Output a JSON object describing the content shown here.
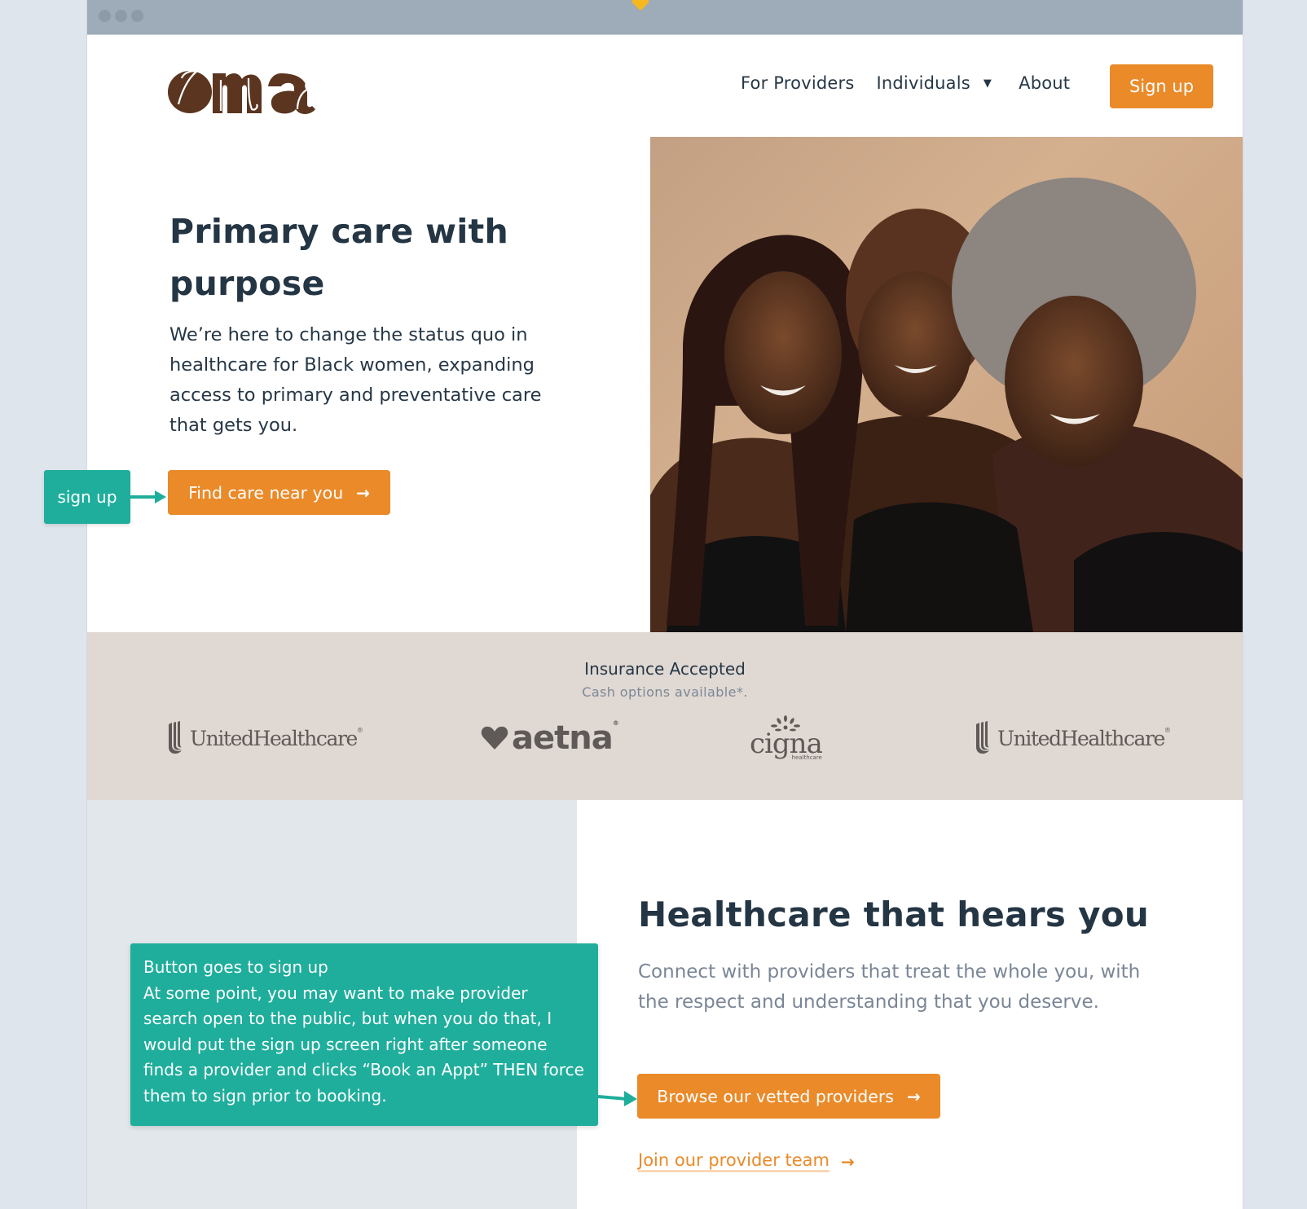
{
  "browser": {
    "window_controls": [
      "close",
      "minimize",
      "maximize"
    ],
    "marker_color": "#f5b820"
  },
  "header": {
    "logo_text": "oma",
    "logo_color": "#5b3520",
    "nav": [
      {
        "label": "For Providers",
        "has_dropdown": false
      },
      {
        "label": "Individuals",
        "has_dropdown": true
      },
      {
        "label": "About",
        "has_dropdown": false
      }
    ],
    "dropdown_icon": "▼",
    "signup_label": "Sign up"
  },
  "hero": {
    "title": "Primary care with purpose",
    "body": "We’re here to change the status quo in healthcare for Black women, expanding access to primary and preventative care that gets you.",
    "cta_label": "Find care near you",
    "cta_arrow": "→",
    "photo_alt": "Three smiling Black women embracing against a tan background"
  },
  "insurance": {
    "title": "Insurance Accepted",
    "subtitle": "Cash options available*.",
    "logos": [
      {
        "name": "UnitedHealthcare",
        "mark": "®"
      },
      {
        "name": "aetna",
        "mark": "®"
      },
      {
        "name": "cigna",
        "sub": "healthcare"
      },
      {
        "name": "UnitedHealthcare",
        "mark": "®"
      }
    ]
  },
  "section": {
    "title": "Healthcare that hears you",
    "body": "Connect with providers that treat the whole you, with the respect and understanding that you deserve.",
    "browse_label": "Browse our vetted providers",
    "browse_arrow": "→",
    "join_label": "Join our provider team",
    "join_arrow": "→"
  },
  "annotations": {
    "small": "sign up",
    "big_lines": [
      "Button goes to sign up",
      "At some point, you may want to make provider search open to the public, but when you do that, I would put the sign up screen right after someone finds a provider and clicks “Book an Appt” THEN force them to sign prior to booking."
    ]
  },
  "colors": {
    "accent": "#ea8a29",
    "annotation": "#1fae9c",
    "heading": "#243544",
    "muted": "#7a8696",
    "band": "#e0d8d3"
  }
}
